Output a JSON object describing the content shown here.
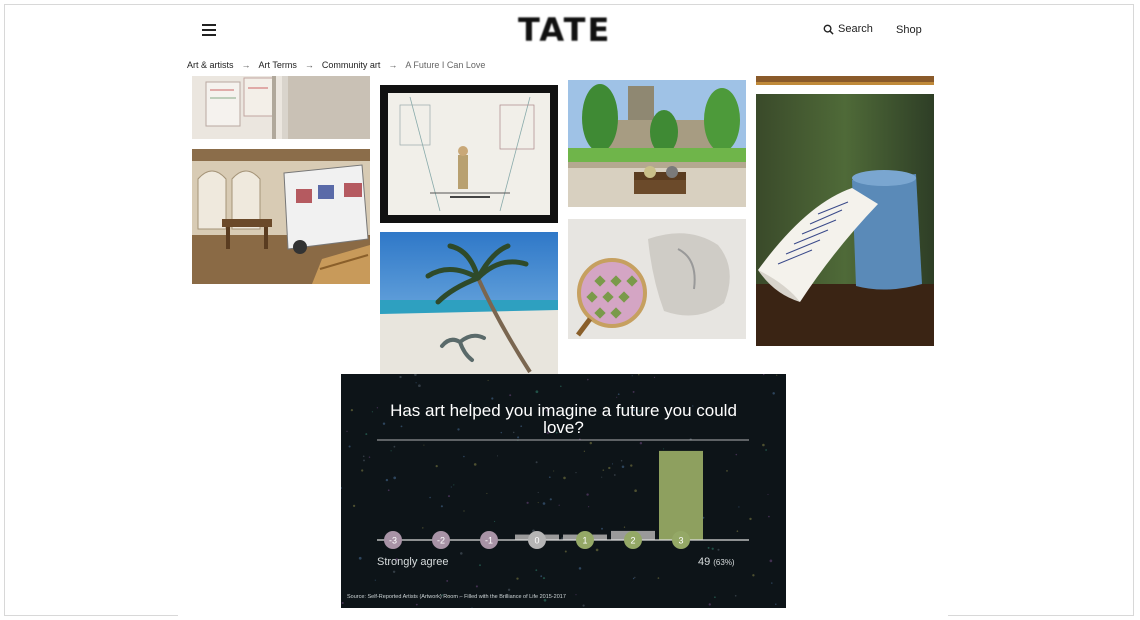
{
  "header": {
    "logo_text": "TATE",
    "search_label": "Search",
    "shop_label": "Shop"
  },
  "breadcrumb": [
    {
      "label": "Art & artists"
    },
    {
      "label": "Art Terms"
    },
    {
      "label": "Community art"
    },
    {
      "label": "A Future I Can Love"
    }
  ],
  "breadcrumb_separator": "→",
  "colors": {
    "chart_background": "#0d1418",
    "chart_bar_gray": "#9a9a9a",
    "chart_bar_green": "#8ea05f",
    "circle_purple": "#a893a6",
    "circle_gray": "#b5b5b5",
    "circle_green": "#94a866"
  },
  "chart_data": {
    "type": "bar",
    "title": "Has art helped you imagine a future you could love?",
    "categories": [
      "-3",
      "-2",
      "-1",
      "0",
      "1",
      "2",
      "3"
    ],
    "values": [
      0,
      0,
      0,
      3,
      3,
      5,
      49
    ],
    "ylim": [
      0,
      55
    ],
    "left_annotation": "Strongly agree",
    "right_annotation": {
      "value": "49",
      "percent": "(63%)"
    },
    "source": "Source: Self-Reported Artists (Artwork) Room – Filled with the Brilliance of Life 2015-2017"
  }
}
